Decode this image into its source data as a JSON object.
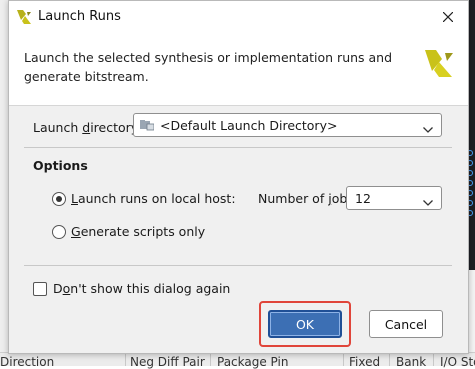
{
  "window": {
    "title": "Launch Runs"
  },
  "header": {
    "description": "Launch the selected synthesis or implementation runs and generate bitstream."
  },
  "launch_directory": {
    "label_pre": "Launch ",
    "label_u": "d",
    "label_post": "irectory:",
    "value": "<Default Launch Directory>"
  },
  "options": {
    "heading": "Options",
    "local_host": {
      "label_pre": "",
      "label_u": "L",
      "label_post": "aunch runs on local host:",
      "selected": true
    },
    "jobs": {
      "label_pre": "Number of ",
      "label_u": "j",
      "label_post": "obs:",
      "value": "12"
    },
    "scripts_only": {
      "label_pre": "",
      "label_u": "G",
      "label_post": "enerate scripts only",
      "selected": false
    }
  },
  "dont_show": {
    "label_pre": "D",
    "label_u": "o",
    "label_post": "n't show this dialog again",
    "checked": false
  },
  "buttons": {
    "ok": "OK",
    "cancel": "Cancel"
  },
  "background_table": {
    "columns": [
      "Direction",
      "Neg Diff Pair",
      "Package Pin",
      "Fixed",
      "Bank",
      "I/O Std"
    ]
  },
  "colors": {
    "accent": "#3c6fb4",
    "highlight": "#e0453a",
    "brand_yellow": "#c9c21a"
  }
}
